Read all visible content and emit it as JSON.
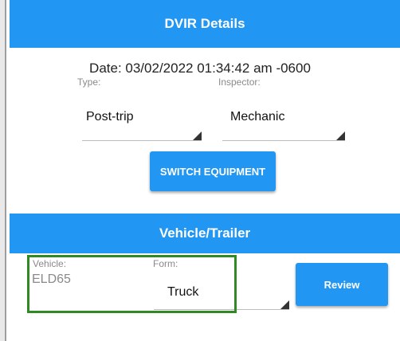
{
  "header": {
    "title": "DVIR Details"
  },
  "details": {
    "date": "Date: 03/02/2022 01:34:42 am -0600",
    "type_label": "Type:",
    "type_value": "Post-trip",
    "inspector_label": "Inspector:",
    "inspector_value": "Mechanic"
  },
  "actions": {
    "switch_equipment": "SWITCH EQUIPMENT"
  },
  "vehicle_section": {
    "title": "Vehicle/Trailer",
    "vehicle_label": "Vehicle:",
    "vehicle_value": "ELD65",
    "form_label": "Form:",
    "form_value": "Truck",
    "review_button": "Review"
  },
  "colors": {
    "primary": "#2196f3",
    "highlight": "#2e8b22"
  }
}
